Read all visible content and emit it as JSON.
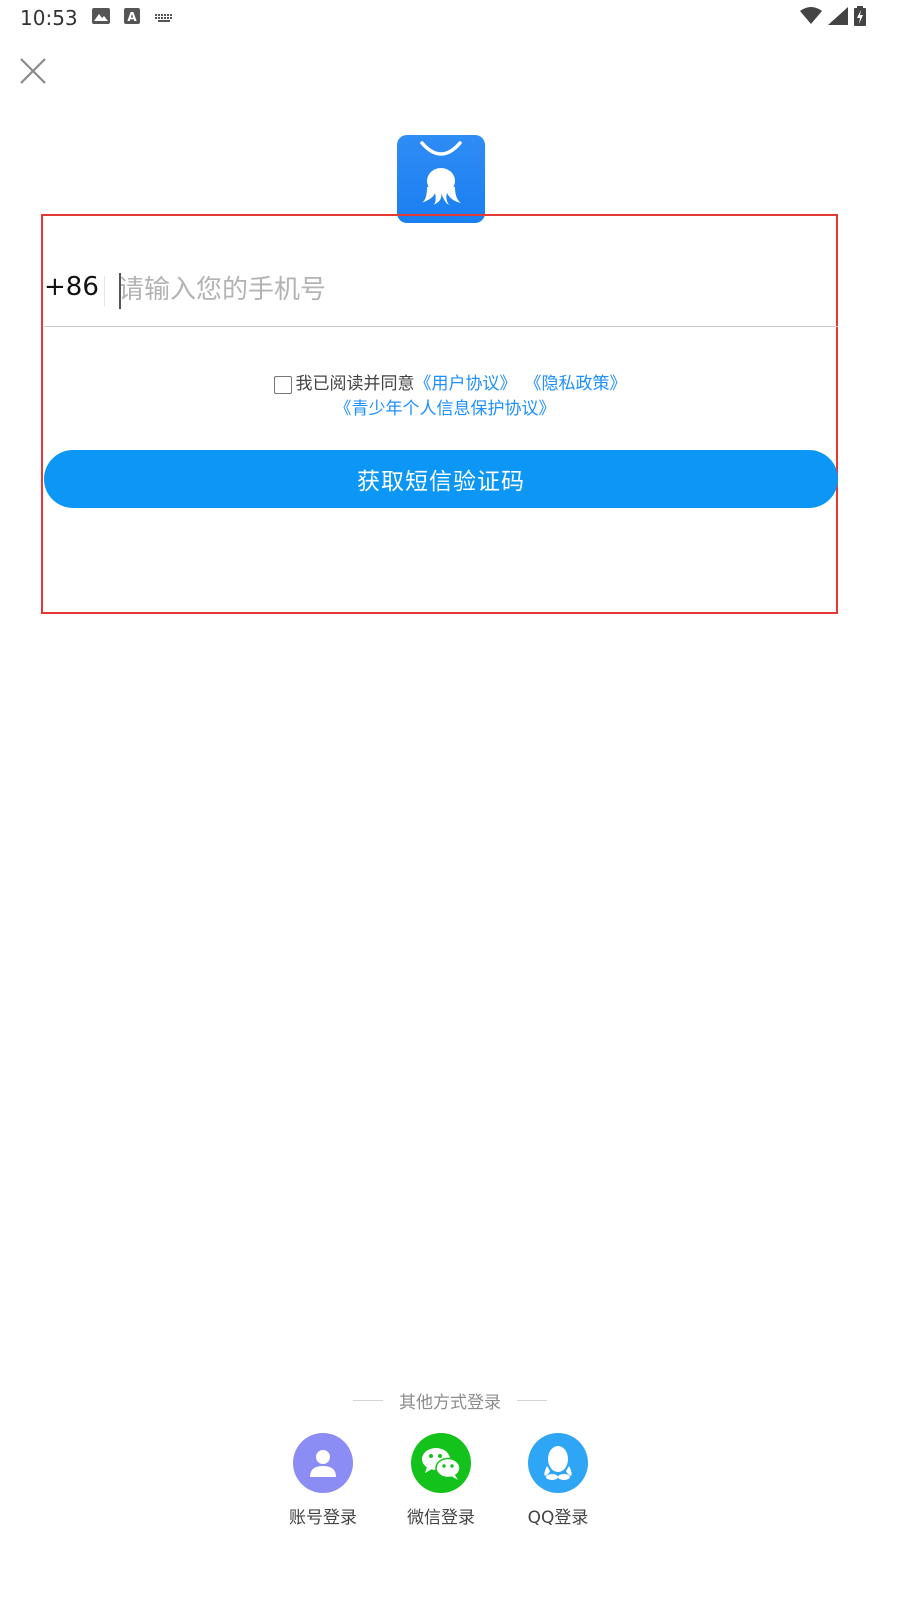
{
  "status_bar": {
    "time": "10:53",
    "left_icons": [
      "image-icon",
      "text-a-icon",
      "keyboard-icon"
    ],
    "right_icons": [
      "wifi-icon",
      "signal-icon",
      "battery-charging-icon"
    ]
  },
  "header": {
    "close_icon": "close-icon"
  },
  "app_logo": {
    "icon": "shopping-bag-octopus-logo",
    "color": "#1a7ff0"
  },
  "phone_form": {
    "country_code": "+86",
    "placeholder": "请输入您的手机号",
    "value": ""
  },
  "agreement": {
    "prefix": "我已阅读并同意",
    "user_agreement": "《用户协议》",
    "privacy_policy": "《隐私政策》",
    "minor_protection": "《青少年个人信息保护协议》",
    "checked": false
  },
  "sms_button": {
    "label": "获取短信验证码",
    "color": "#0c96f6"
  },
  "other_login": {
    "title": "其他方式登录",
    "options": [
      {
        "label": "账号登录",
        "icon": "user-icon",
        "color": "#8c8cf5"
      },
      {
        "label": "微信登录",
        "icon": "wechat-icon",
        "color": "#13c21a"
      },
      {
        "label": "QQ登录",
        "icon": "qq-icon",
        "color": "#2fa6f5"
      }
    ]
  }
}
